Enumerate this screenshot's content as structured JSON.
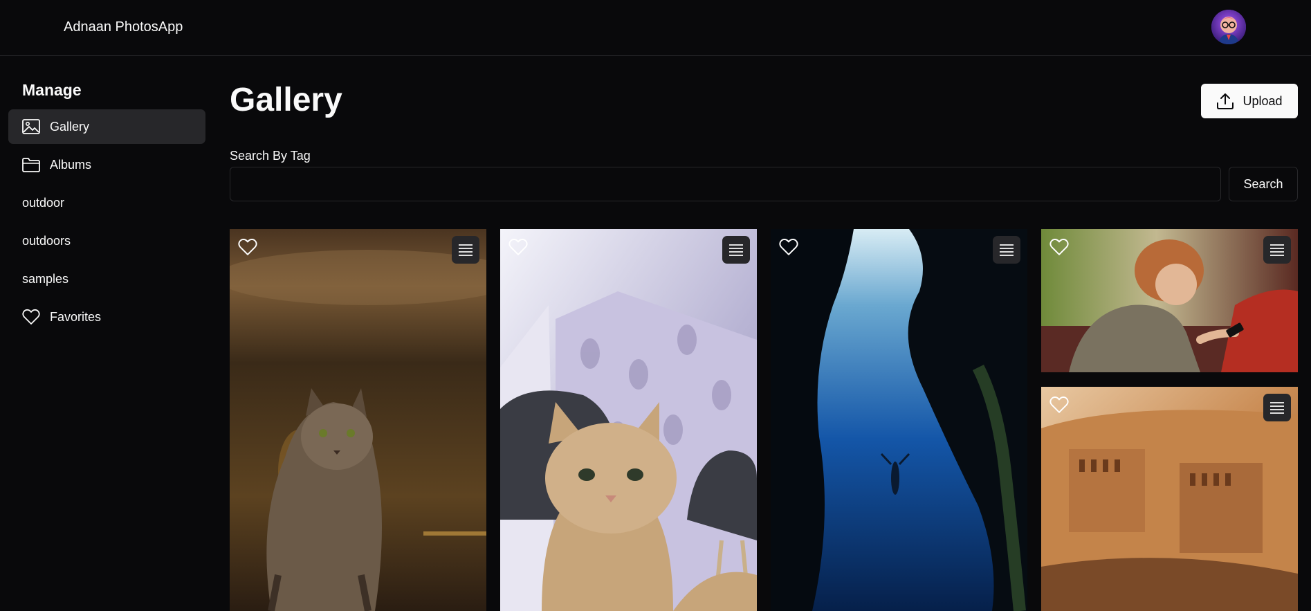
{
  "app": {
    "title": "Adnaan PhotosApp"
  },
  "sidebar": {
    "heading": "Manage",
    "items": [
      {
        "label": "Gallery",
        "icon": "image-icon",
        "active": true
      },
      {
        "label": "Albums",
        "icon": "folder-icon"
      },
      {
        "label": "outdoor"
      },
      {
        "label": "outdoors"
      },
      {
        "label": "samples"
      },
      {
        "label": "Favorites",
        "icon": "heart-icon"
      }
    ]
  },
  "main": {
    "title": "Gallery",
    "upload_label": "Upload",
    "search": {
      "label": "Search By Tag",
      "value": "",
      "placeholder": "",
      "button_label": "Search"
    },
    "photos": [
      {
        "subject": "tabby cat walking",
        "icon": "heart-icon"
      },
      {
        "subject": "cat lying near chairs",
        "icon": "heart-icon"
      },
      {
        "subject": "diver in underwater cave",
        "icon": "heart-icon"
      },
      {
        "subject": "person with phone",
        "icon": "heart-icon"
      },
      {
        "subject": "carved rock ruins",
        "icon": "heart-icon"
      }
    ]
  },
  "colors": {
    "background": "#09090b",
    "surface_active": "#27272a",
    "border": "#27272a",
    "text": "#fafafa",
    "button_light": "#fafafa"
  }
}
